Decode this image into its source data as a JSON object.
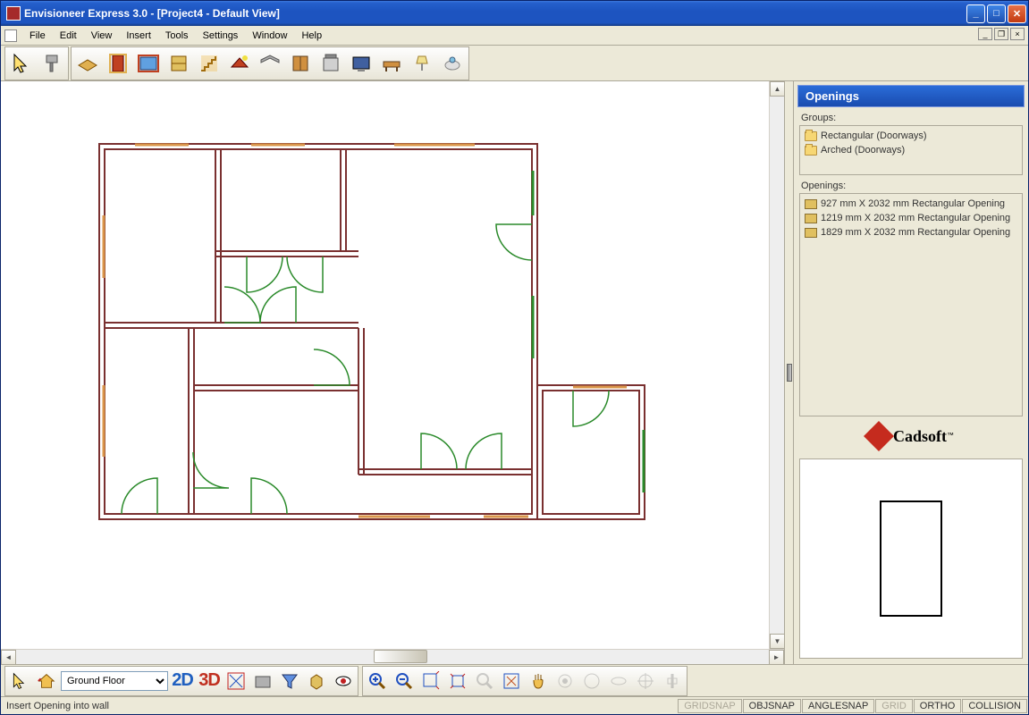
{
  "title": "Envisioneer Express 3.0 - [Project4 - Default View]",
  "menu": [
    "File",
    "Edit",
    "View",
    "Insert",
    "Tools",
    "Settings",
    "Window",
    "Help"
  ],
  "toolbar_icons": [
    "select",
    "paint",
    "wall",
    "door",
    "window",
    "wall-panel",
    "stairs",
    "roof-wizard",
    "ceiling",
    "cabinet",
    "appliance",
    "tv",
    "furniture",
    "lamp",
    "fixture"
  ],
  "sidepanel": {
    "title": "Openings",
    "groups_label": "Groups:",
    "groups": [
      "Rectangular (Doorways)",
      "Arched (Doorways)"
    ],
    "openings_label": "Openings:",
    "openings": [
      "927 mm X 2032 mm Rectangular Opening",
      "1219 mm X 2032 mm Rectangular Opening",
      "1829 mm X 2032 mm Rectangular Opening"
    ],
    "brand": "Cadsoft",
    "brand_tm": "™"
  },
  "bottom": {
    "floor": "Ground Floor",
    "btn2d": "2D",
    "btn3d": "3D"
  },
  "status": {
    "message": "Insert Opening into wall",
    "cells": [
      {
        "label": "GRIDSNAP",
        "dim": true
      },
      {
        "label": "OBJSNAP",
        "dim": false
      },
      {
        "label": "ANGLESNAP",
        "dim": false
      },
      {
        "label": "GRID",
        "dim": true
      },
      {
        "label": "ORTHO",
        "dim": false
      },
      {
        "label": "COLLISION",
        "dim": false
      }
    ]
  }
}
